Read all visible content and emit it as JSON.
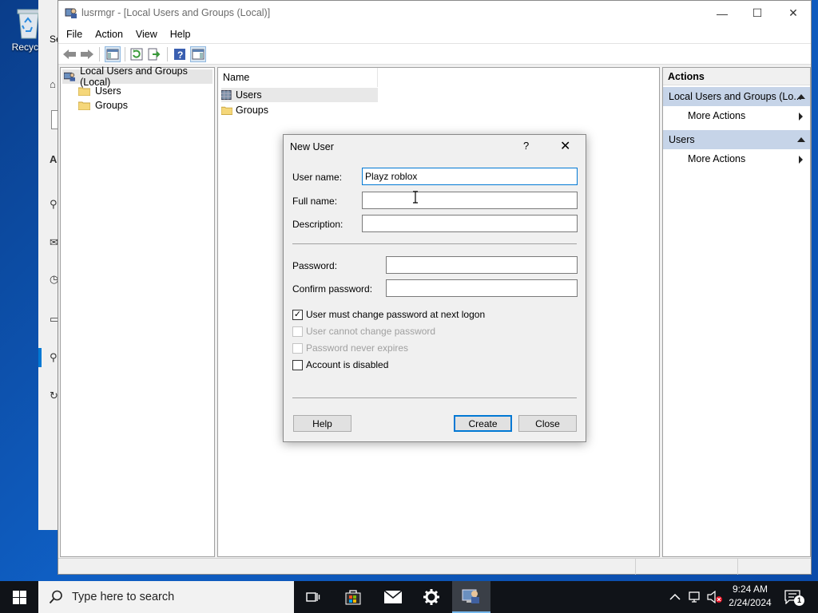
{
  "desktop": {
    "recycle_bin_label": "Recycle",
    "partial_window_title_fragment": "Se",
    "partial_window_letter": "A"
  },
  "window": {
    "title": "lusrmgr - [Local Users and Groups (Local)]",
    "controls": {
      "minimize": "—",
      "maximize": "☐",
      "close": "✕"
    }
  },
  "menu": [
    "File",
    "Action",
    "View",
    "Help"
  ],
  "tree": {
    "root": "Local Users and Groups (Local)",
    "children": [
      "Users",
      "Groups"
    ]
  },
  "list": {
    "column_header": "Name",
    "items": [
      "Users",
      "Groups"
    ]
  },
  "actions": {
    "header": "Actions",
    "sections": [
      {
        "title": "Local Users and Groups (Lo...",
        "item": "More Actions"
      },
      {
        "title": "Users",
        "item": "More Actions"
      }
    ]
  },
  "dialog": {
    "title": "New User",
    "help_glyph": "?",
    "close_glyph": "✕",
    "fields": {
      "user_name_label": "User name:",
      "user_name_value": "Playz roblox",
      "full_name_label": "Full name:",
      "full_name_value": "",
      "description_label": "Description:",
      "description_value": "",
      "password_label": "Password:",
      "password_value": "",
      "confirm_password_label": "Confirm password:",
      "confirm_password_value": ""
    },
    "checkboxes": [
      {
        "label": "User must change password at next logon",
        "checked": true,
        "enabled": true
      },
      {
        "label": "User cannot change password",
        "checked": false,
        "enabled": false
      },
      {
        "label": "Password never expires",
        "checked": false,
        "enabled": false
      },
      {
        "label": "Account is disabled",
        "checked": false,
        "enabled": true
      }
    ],
    "buttons": {
      "help": "Help",
      "create": "Create",
      "close": "Close"
    }
  },
  "taskbar": {
    "search_placeholder": "Type here to search",
    "clock_time": "9:24 AM",
    "clock_date": "2/24/2024",
    "notification_count": "1"
  },
  "colors": {
    "accent": "#0078d4",
    "action_section_bg": "#c6d4e8",
    "taskbar_bg": "#101318"
  }
}
